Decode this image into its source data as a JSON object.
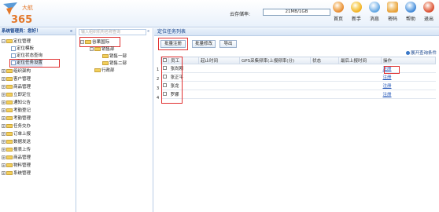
{
  "header": {
    "logo_text": "365",
    "logo_small": "大航",
    "storage_label": "云存储率:",
    "storage_value": "21MB/1GB",
    "nav": [
      {
        "label": "首页",
        "icon": "home-icon",
        "color": "#e7892d"
      },
      {
        "label": "新手",
        "icon": "beginner-icon",
        "color": "#f2b01f"
      },
      {
        "label": "消息",
        "icon": "message-icon",
        "color": "#5ba2e0"
      },
      {
        "label": "密码",
        "icon": "password-icon",
        "color": "#e8a23a"
      },
      {
        "label": "帮助",
        "icon": "help-icon",
        "color": "#3d86d6"
      },
      {
        "label": "退出",
        "icon": "exit-icon",
        "color": "#d94a2c"
      }
    ]
  },
  "sidebar": {
    "title": "系统管理员：您好！",
    "collapse": "«",
    "items": [
      {
        "label": "定位管理",
        "level": 0,
        "type": "folder",
        "expanded": true
      },
      {
        "label": "定位模板",
        "level": 1,
        "type": "doc"
      },
      {
        "label": "定位状态查询",
        "level": 1,
        "type": "doc"
      },
      {
        "label": "定位任务设置",
        "level": 1,
        "type": "doc",
        "selected": true
      },
      {
        "label": "组织架构",
        "level": 0,
        "type": "folder"
      },
      {
        "label": "客户管理",
        "level": 0,
        "type": "folder"
      },
      {
        "label": "商品管理",
        "level": 0,
        "type": "folder"
      },
      {
        "label": "立即定位",
        "level": 0,
        "type": "folder"
      },
      {
        "label": "通知公告",
        "level": 0,
        "type": "folder"
      },
      {
        "label": "考勤登记",
        "level": 0,
        "type": "folder"
      },
      {
        "label": "考勤管理",
        "level": 0,
        "type": "folder"
      },
      {
        "label": "任务交办",
        "level": 0,
        "type": "folder"
      },
      {
        "label": "订单上报",
        "level": 0,
        "type": "folder"
      },
      {
        "label": "数据发送",
        "level": 0,
        "type": "folder"
      },
      {
        "label": "报表上传",
        "level": 0,
        "type": "folder"
      },
      {
        "label": "商品管理",
        "level": 0,
        "type": "folder"
      },
      {
        "label": "物料管理",
        "level": 0,
        "type": "folder"
      },
      {
        "label": "系统管理",
        "level": 0,
        "type": "folder"
      }
    ]
  },
  "org": {
    "search_placeholder": "输入组织机构名称查询",
    "collapse": "«",
    "tree": [
      {
        "label": "谷果国际",
        "level": 0
      },
      {
        "label": "销售部",
        "level": 1
      },
      {
        "label": "销售一部",
        "level": 2
      },
      {
        "label": "销售二部",
        "level": 2
      },
      {
        "label": "行政部",
        "level": 1
      }
    ]
  },
  "main": {
    "title": "定位任务列表",
    "buttons": [
      "批量注册",
      "批量修改",
      "导出"
    ],
    "expand_query": "展开查询条件",
    "columns": [
      "员工",
      "起止时间",
      "GPS采集频率(上报频率(分)",
      "状态",
      "最后上报时间",
      "操作"
    ],
    "rows": [
      {
        "num": "1",
        "name": "张尚刚",
        "action": "注册"
      },
      {
        "num": "2",
        "name": "张正平",
        "action": "注册"
      },
      {
        "num": "3",
        "name": "张龙",
        "action": "注册"
      },
      {
        "num": "4",
        "name": "罗娜",
        "action": "注册"
      }
    ]
  }
}
